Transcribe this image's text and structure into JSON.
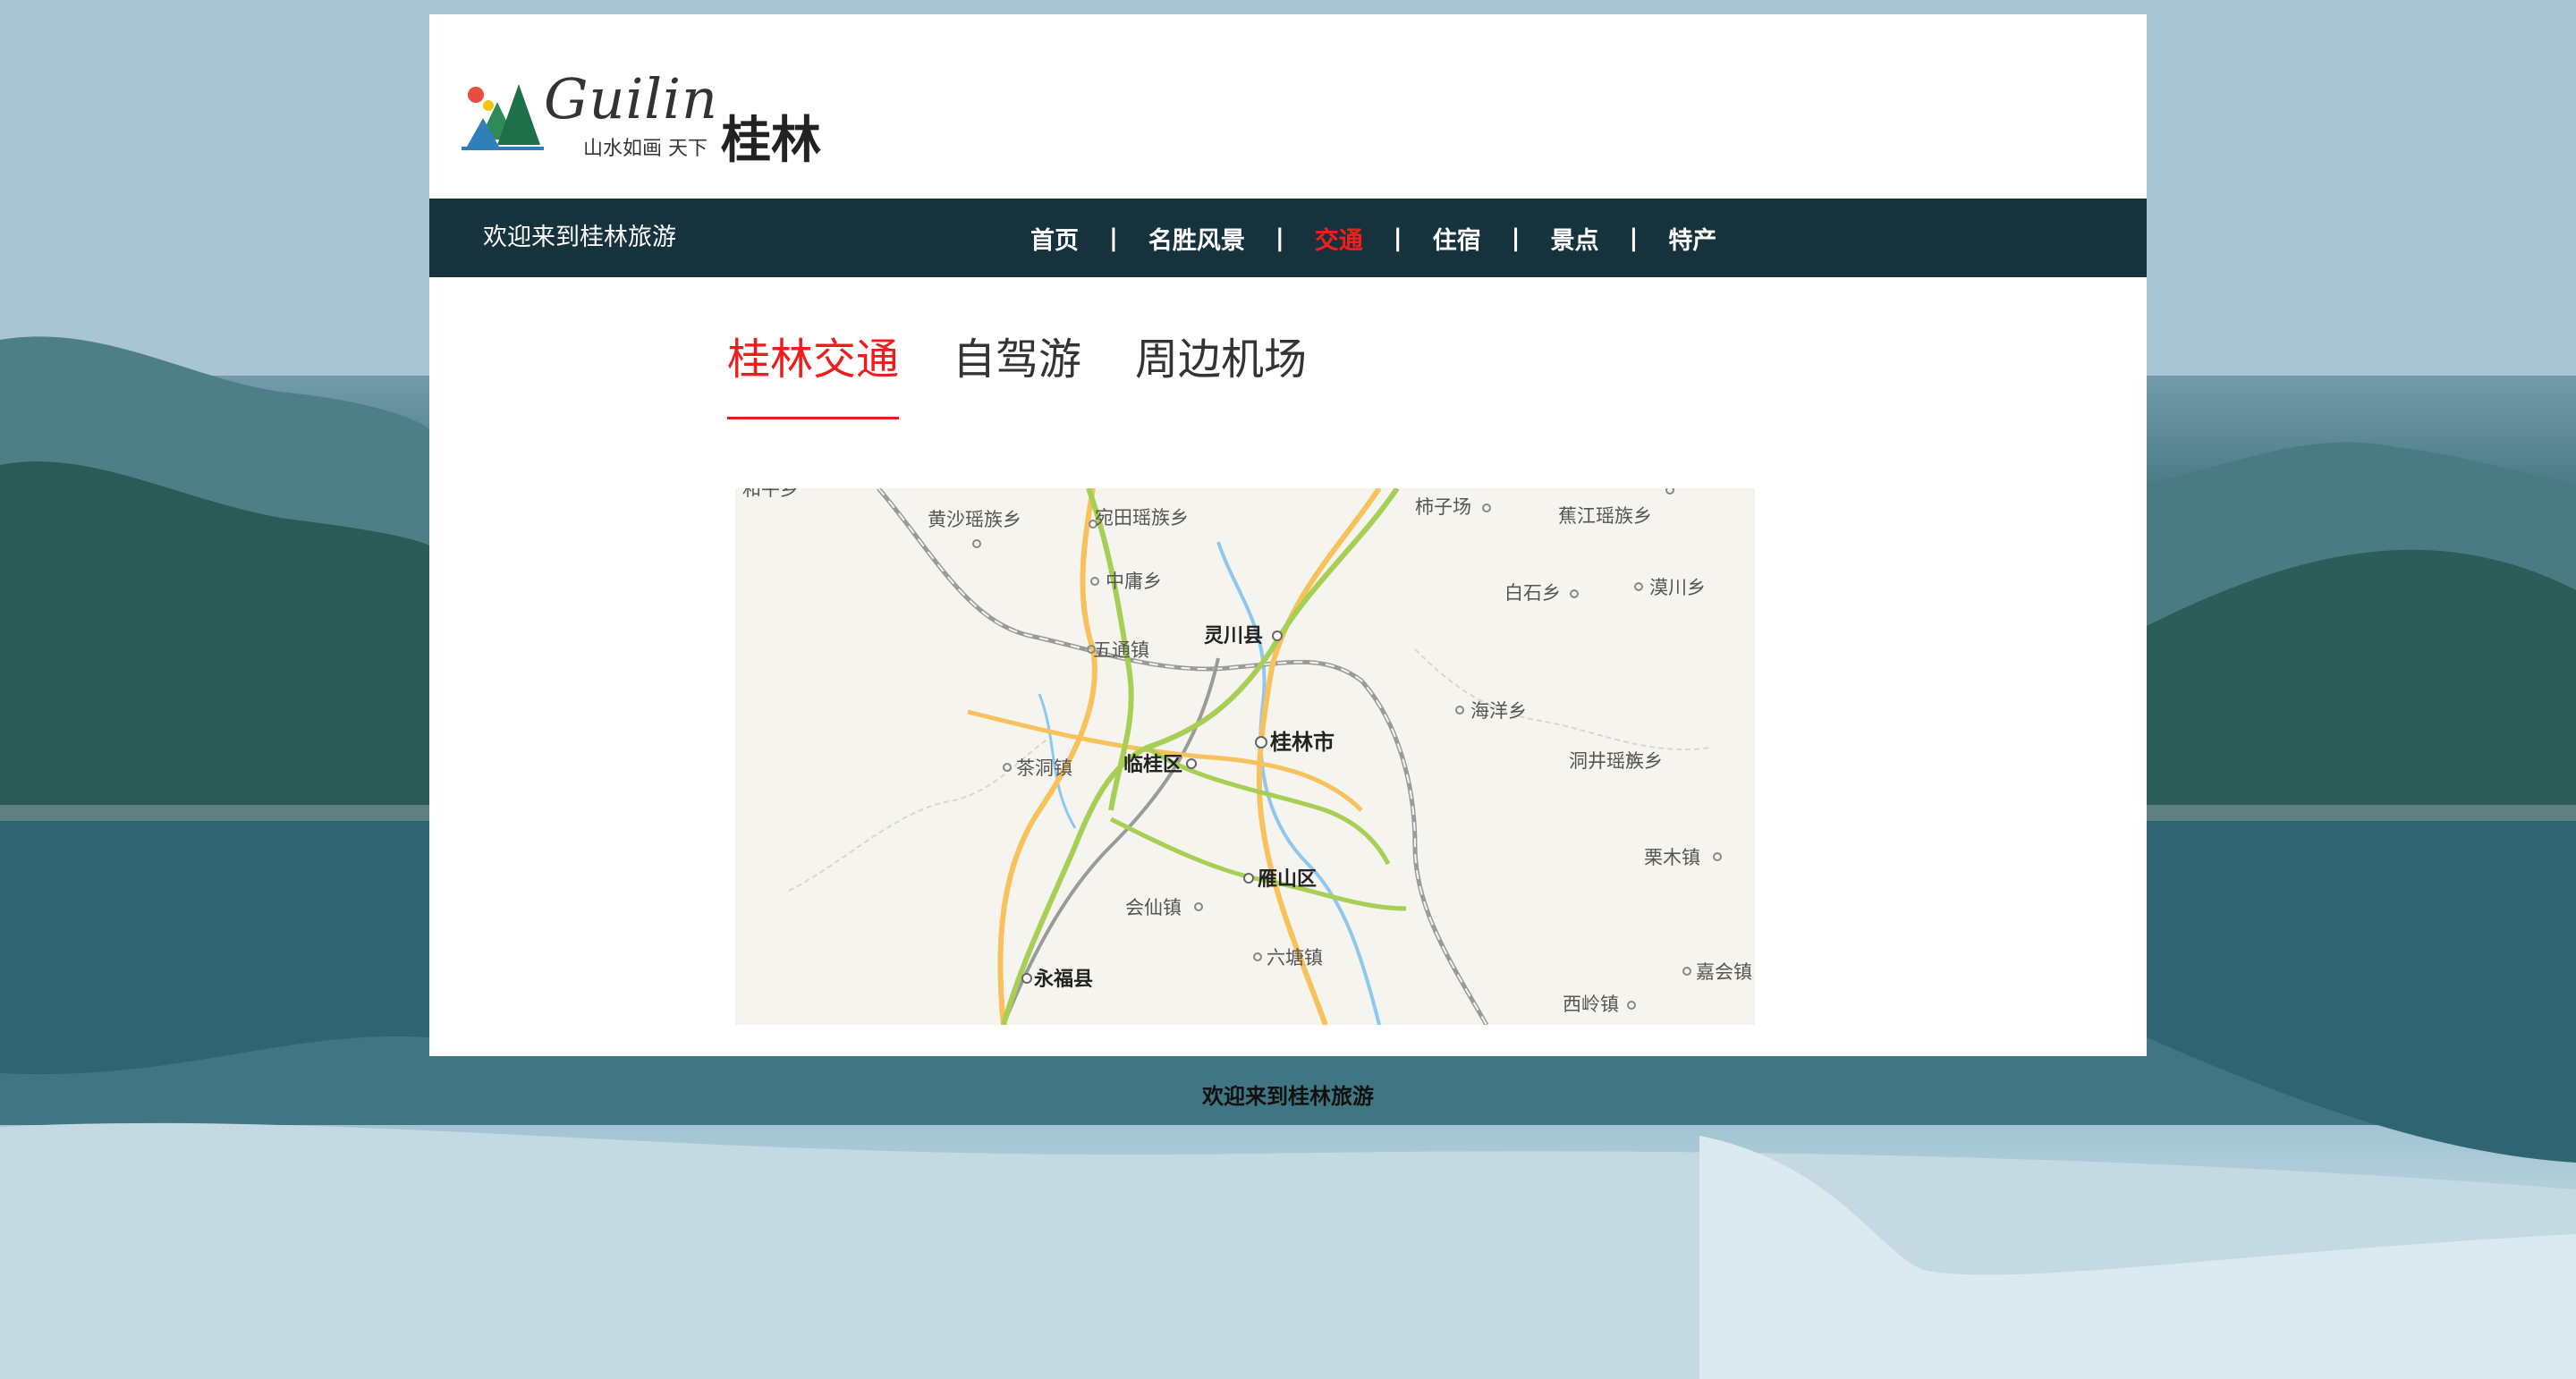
{
  "logo": {
    "word": "Guilin",
    "subtitle": "山水如画 天下",
    "name_cn": "桂林"
  },
  "navbar": {
    "welcome": "欢迎来到桂林旅游",
    "items": [
      {
        "label": "首页"
      },
      {
        "label": "名胜风景"
      },
      {
        "label": "交通",
        "active": true
      },
      {
        "label": "住宿"
      },
      {
        "label": "景点"
      },
      {
        "label": "特产"
      }
    ],
    "separator": "|"
  },
  "tabs": [
    {
      "label": "桂林交通",
      "active": true
    },
    {
      "label": "自驾游"
    },
    {
      "label": "周边机场"
    }
  ],
  "map": {
    "labels": {
      "huangsha": "黄沙瑶族乡",
      "wantian": "宛田瑶族乡",
      "shiziyang": "柿子场",
      "jiaojiang": "蕉江瑶族乡",
      "baishi": "白石乡",
      "lanchuan": "漠川乡",
      "zhongyong": "中庸乡",
      "lingchuan": "灵川县",
      "wutong": "五通镇",
      "haiyang": "海洋乡",
      "guilin": "桂林市",
      "chadong": "茶洞镇",
      "lingui": "临桂区",
      "dongjing": "洞井瑶族乡",
      "limu": "栗木镇",
      "yanshan": "雁山区",
      "huixian": "会仙镇",
      "liutang": "六塘镇",
      "yongfu": "永福县",
      "jiahui": "嘉会镇",
      "xiling": "西岭镇",
      "heping": "和平乡"
    }
  },
  "footer": {
    "text": "欢迎来到桂林旅游"
  },
  "colors": {
    "navbar_bg": "#16333d",
    "accent": "#ee1d1d",
    "page_bg": "#ffffff"
  }
}
